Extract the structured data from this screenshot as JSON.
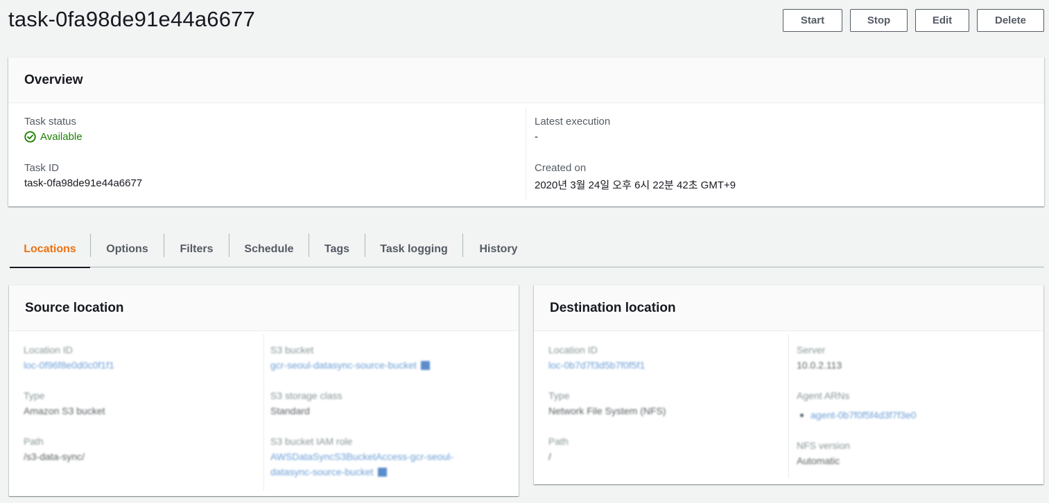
{
  "page": {
    "title": "task-0fa98de91e44a6677"
  },
  "actions": {
    "start": "Start",
    "stop": "Stop",
    "edit": "Edit",
    "delete": "Delete"
  },
  "overview": {
    "heading": "Overview",
    "task_status_label": "Task status",
    "task_status_value": "Available",
    "task_id_label": "Task ID",
    "task_id_value": "task-0fa98de91e44a6677",
    "latest_execution_label": "Latest execution",
    "latest_execution_value": "-",
    "created_on_label": "Created on",
    "created_on_value": "2020년 3월 24일 오후 6시 22분 42초 GMT+9"
  },
  "tabs": [
    "Locations",
    "Options",
    "Filters",
    "Schedule",
    "Tags",
    "Task logging",
    "History"
  ],
  "active_tab": "Locations",
  "source": {
    "heading": "Source location",
    "location_id_label": "Location ID",
    "location_id_value": "loc-0f96f8e0d0c0f1f1",
    "type_label": "Type",
    "type_value": "Amazon S3 bucket",
    "path_label": "Path",
    "path_value": "/s3-data-sync/",
    "s3_bucket_label": "S3 bucket",
    "s3_bucket_value": "gcr-seoul-datasync-source-bucket",
    "s3_storage_class_label": "S3 storage class",
    "s3_storage_class_value": "Standard",
    "s3_role_label": "S3 bucket IAM role",
    "s3_role_value_line1": "AWSDataSyncS3BucketAccess-gcr-seoul-",
    "s3_role_value_line2": "datasync-source-bucket"
  },
  "destination": {
    "heading": "Destination location",
    "location_id_label": "Location ID",
    "location_id_value": "loc-0b7d7f3d5b7f0f5f1",
    "type_label": "Type",
    "type_value": "Network File System (NFS)",
    "path_label": "Path",
    "path_value": "/",
    "server_label": "Server",
    "server_value": "10.0.2.113",
    "agent_arns_label": "Agent ARNs",
    "agent_arn_value": "agent-0b7f0f5f4d3f7f3e0",
    "nfs_version_label": "NFS version",
    "nfs_version_value": "Automatic"
  },
  "colors": {
    "accent": "#ec7211",
    "success": "#1d8102",
    "link": "#0073bb"
  }
}
